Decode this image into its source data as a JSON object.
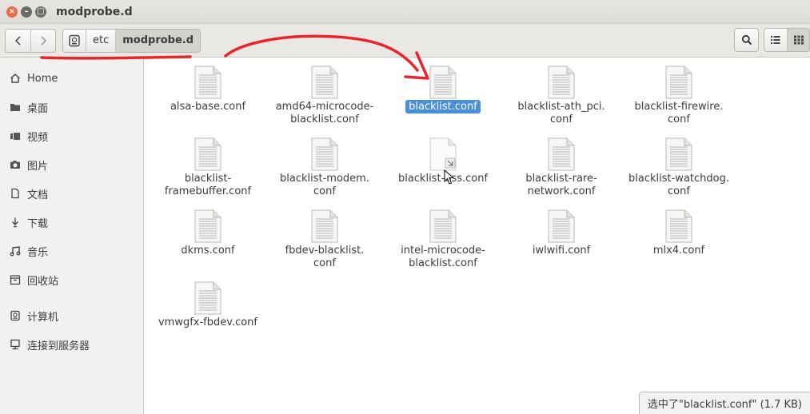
{
  "window": {
    "title": "modprobe.d"
  },
  "toolbar": {
    "path": [
      "etc",
      "modprobe.d"
    ]
  },
  "sidebar": {
    "items": [
      {
        "label": "Home",
        "icon": "home-icon"
      },
      {
        "label": "桌面",
        "icon": "folder-icon"
      },
      {
        "label": "视频",
        "icon": "video-icon"
      },
      {
        "label": "图片",
        "icon": "camera-icon"
      },
      {
        "label": "文档",
        "icon": "document-icon"
      },
      {
        "label": "下载",
        "icon": "download-icon"
      },
      {
        "label": "音乐",
        "icon": "music-icon"
      },
      {
        "label": "回收站",
        "icon": "trash-icon"
      }
    ],
    "devices": [
      {
        "label": "计算机",
        "icon": "computer-icon"
      },
      {
        "label": "连接到服务器",
        "icon": "server-icon"
      }
    ]
  },
  "files": [
    {
      "line1": "alsa-base.conf",
      "line2": ""
    },
    {
      "line1": "amd64-microcode-",
      "line2": "blacklist.conf"
    },
    {
      "line1": "blacklist.conf",
      "line2": "",
      "selected": true
    },
    {
      "line1": "blacklist-ath_pci.",
      "line2": "conf"
    },
    {
      "line1": "blacklist-firewire.",
      "line2": "conf"
    },
    {
      "line1": "blacklist-",
      "line2": "framebuffer.conf"
    },
    {
      "line1": "blacklist-modem.",
      "line2": "conf"
    },
    {
      "line1": "blacklist-oss.conf",
      "line2": "",
      "symlink": true
    },
    {
      "line1": "blacklist-rare-",
      "line2": "network.conf"
    },
    {
      "line1": "blacklist-watchdog.",
      "line2": "conf"
    },
    {
      "line1": "dkms.conf",
      "line2": ""
    },
    {
      "line1": "fbdev-blacklist.",
      "line2": "conf"
    },
    {
      "line1": "intel-microcode-",
      "line2": "blacklist.conf"
    },
    {
      "line1": "iwlwifi.conf",
      "line2": ""
    },
    {
      "line1": "mlx4.conf",
      "line2": ""
    },
    {
      "line1": "vmwgfx-fbdev.conf",
      "line2": ""
    }
  ],
  "status": {
    "text": "选中了\"blacklist.conf\" (1.7 KB)"
  },
  "colors": {
    "selection": "#4a90d9",
    "annotation": "#e8262a"
  }
}
